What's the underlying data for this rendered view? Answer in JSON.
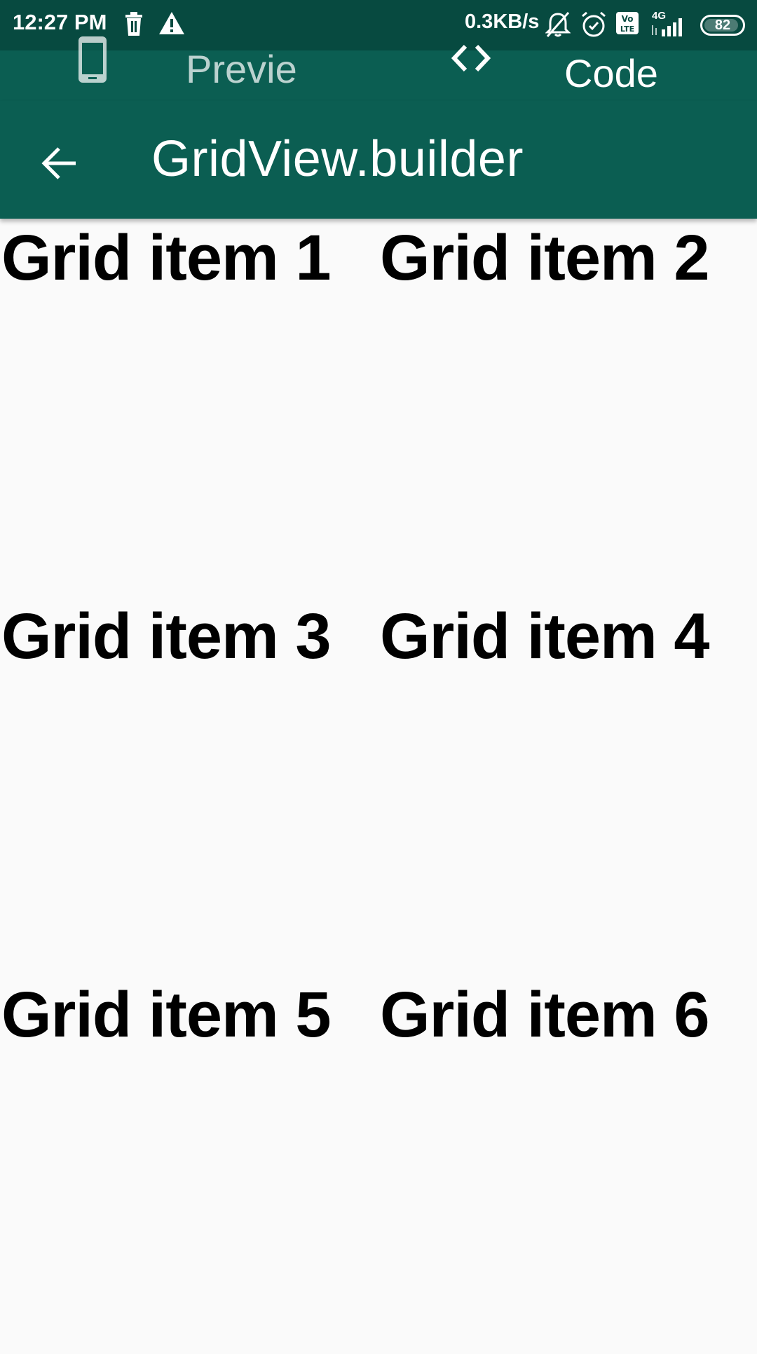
{
  "status_bar": {
    "time": "12:27 PM",
    "network_speed": "0.3KB/s",
    "network_type": "4G",
    "volte": "Vo LTE",
    "battery": "82",
    "icons": [
      "trash-icon",
      "warning-icon",
      "muted-bell-icon",
      "alarm-icon",
      "volte-icon",
      "signal-icon",
      "battery-icon"
    ]
  },
  "tabs": [
    {
      "label": "Preview",
      "icon": "phone-icon"
    },
    {
      "label": "Code",
      "icon": "code-icon"
    }
  ],
  "app_bar": {
    "title": "GridView.builder",
    "back_icon": "arrow-back-icon"
  },
  "grid": {
    "items": [
      "Grid item 1",
      "Grid item 2",
      "Grid item 3",
      "Grid item 4",
      "Grid item 5",
      "Grid item 6"
    ]
  },
  "colors": {
    "status_bar": "#074a40",
    "app_bar": "#0b5e52",
    "background": "#fafafa",
    "text": "#000000"
  }
}
